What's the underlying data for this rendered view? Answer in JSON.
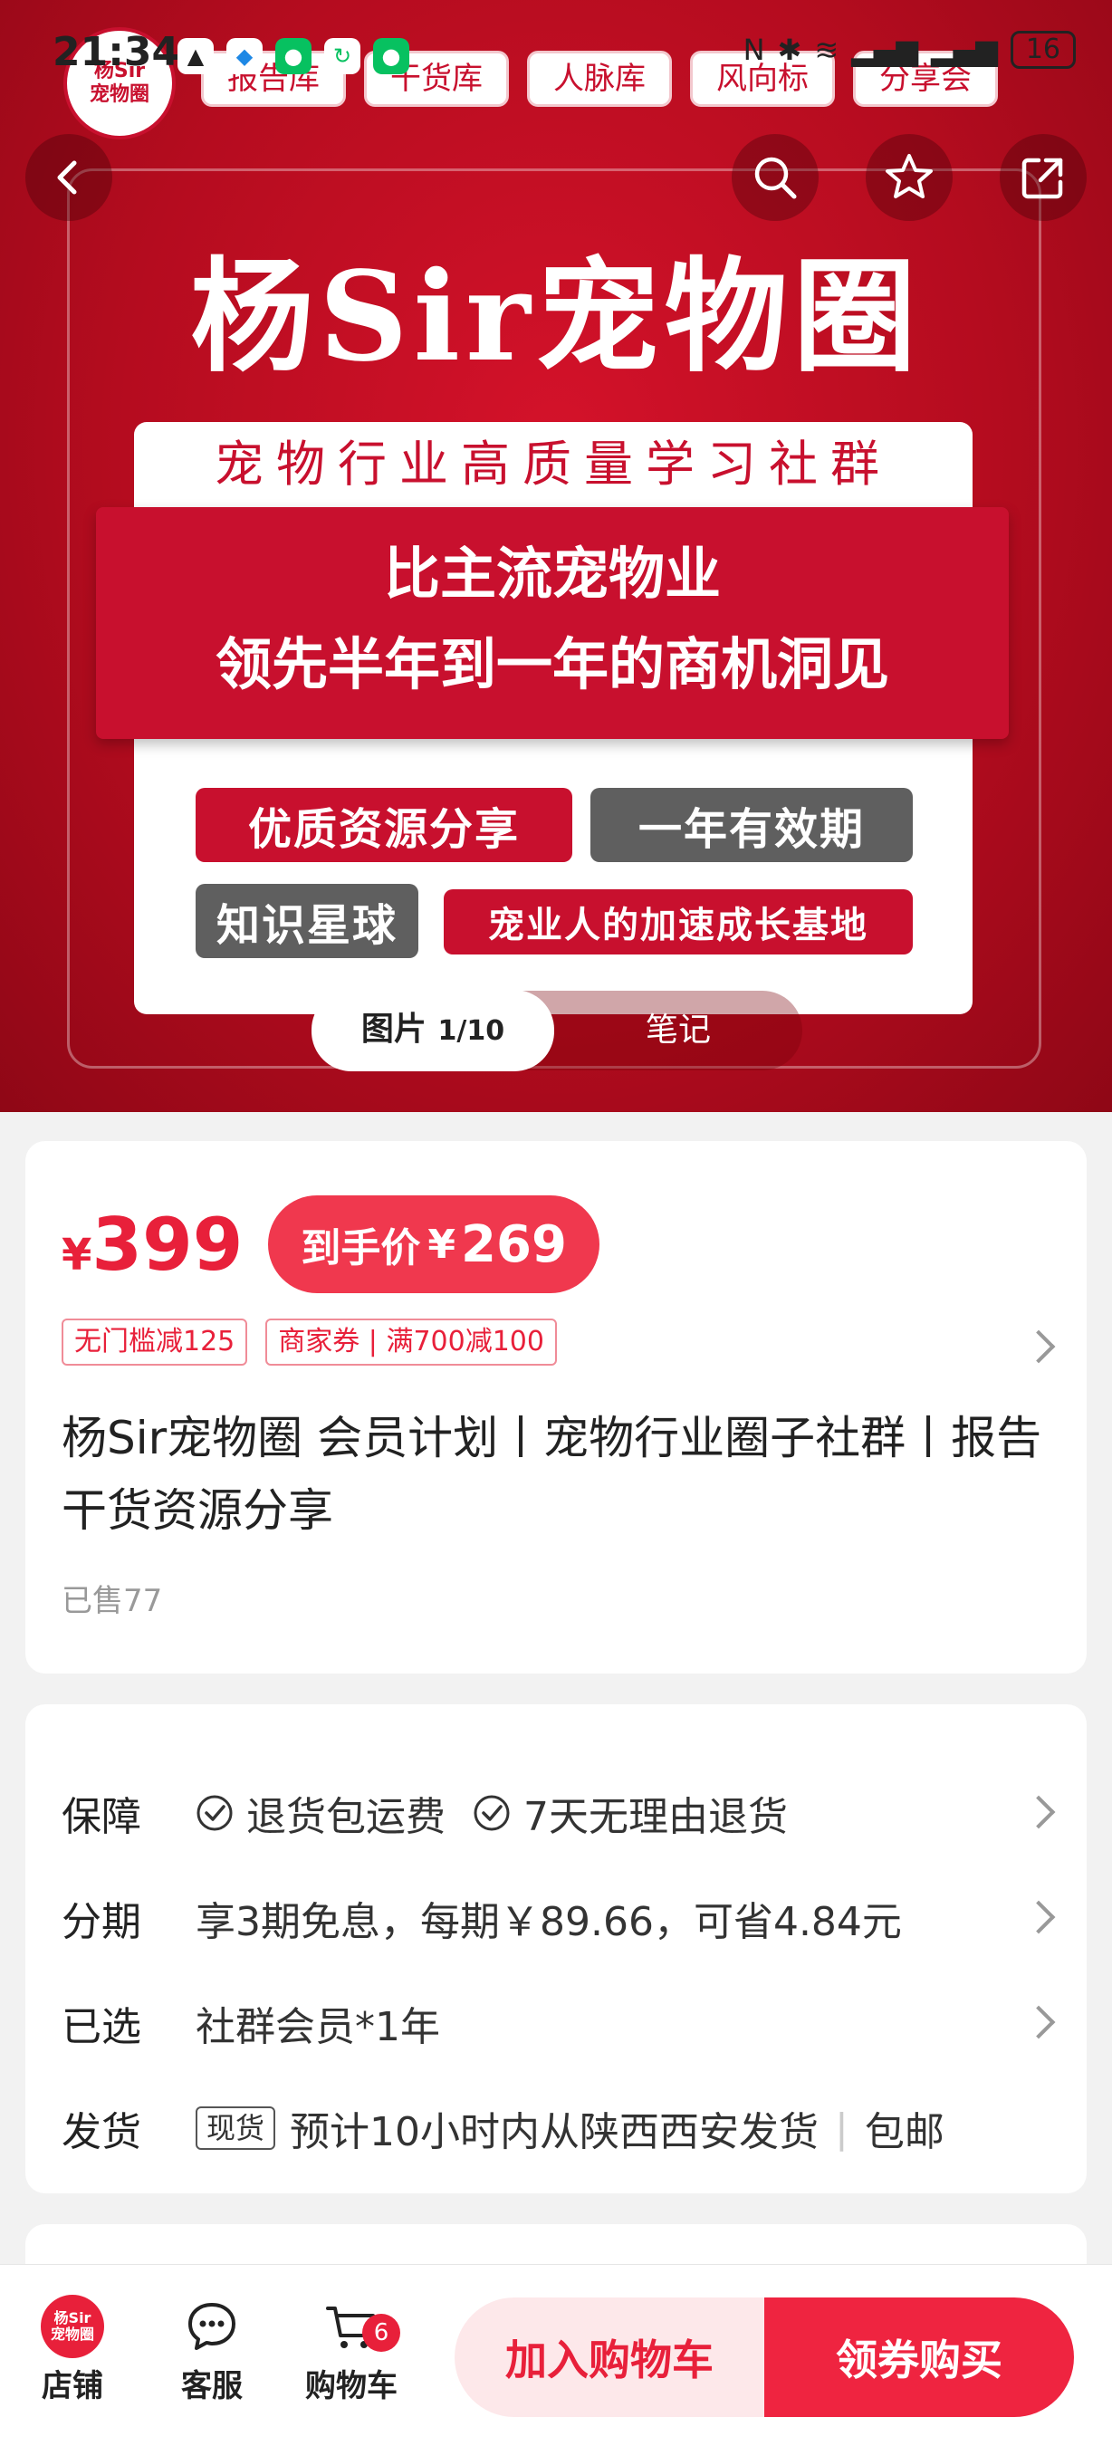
{
  "status_bar": {
    "time": "21:34",
    "battery": "16"
  },
  "hero": {
    "brand_logo_lines": [
      "杨Sir",
      "宠物圈"
    ],
    "top_tags": [
      "报告库",
      "干货库",
      "人脉库",
      "风向标",
      "分享会"
    ],
    "title": "杨Sir宠物圈",
    "subtitle": "宠物行业高质量学习社群",
    "banner_line1": "比主流宠物业",
    "banner_line2": "领先半年到一年的商机洞见",
    "pills": [
      "优质资源分享",
      "一年有效期",
      "知识星球",
      "宠业人的加速成长基地"
    ],
    "media_tabs": {
      "pictures_label": "图片",
      "pictures_count": "1/10",
      "notes_label": "笔记"
    }
  },
  "price_card": {
    "currency": "¥",
    "price": "399",
    "hand_price_label": "到手价",
    "hand_price_currency": "¥",
    "hand_price": "269",
    "coupons": [
      "无门槛减125",
      "商家券 | 满700减100"
    ],
    "title": "杨Sir宠物圈 会员计划丨宠物行业圈子社群丨报告干货资源分享",
    "sold": "已售77"
  },
  "service_card": {
    "guarantee_label": "保障",
    "guarantee_items": [
      "退货包运费",
      "7天无理由退货"
    ],
    "installment_label": "分期",
    "installment_value": "享3期免息，每期￥89.66，可省4.84元",
    "selected_label": "已选",
    "selected_value": "社群会员*1年",
    "shipping_label": "发货",
    "shipping_tag": "现货",
    "shipping_value": "预计10小时内从陕西西安发货",
    "shipping_extra": "包邮"
  },
  "bottom_bar": {
    "shop_label": "店铺",
    "shop_logo_lines": [
      "杨Sir",
      "宠物圈"
    ],
    "service_label": "客服",
    "cart_label": "购物车",
    "cart_badge": "6",
    "add_to_cart": "加入购物车",
    "buy_now": "领券购买"
  },
  "colors": {
    "accent": "#e8203a",
    "hero_red": "#c8102e"
  }
}
